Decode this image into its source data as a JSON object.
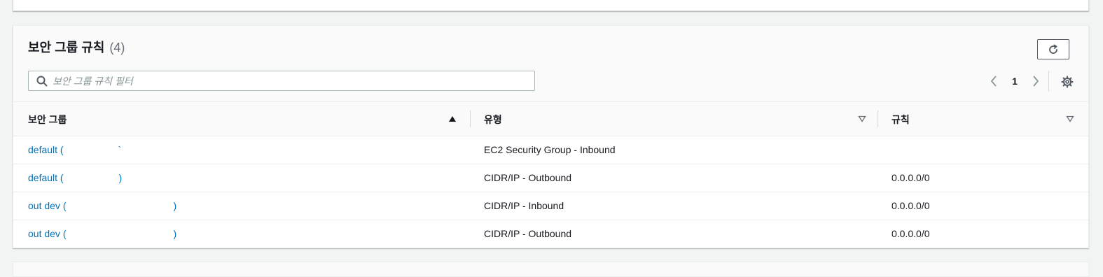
{
  "panel": {
    "title": "보안 그룹 규칙",
    "count": "(4)"
  },
  "search": {
    "placeholder": "보안 그룹 규칙 필터",
    "value": ""
  },
  "pagination": {
    "current_page": "1"
  },
  "icons": {
    "refresh": "refresh-icon",
    "search": "search-icon",
    "prev": "chevron-left-icon",
    "next": "chevron-right-icon",
    "settings": "gear-icon",
    "sort_asc": "sort-ascending-icon",
    "sort_none": "sort-descending-outline-icon"
  },
  "table": {
    "columns": [
      {
        "label": "보안 그룹",
        "sort": "ascending"
      },
      {
        "label": "유형",
        "sort": "none"
      },
      {
        "label": "규칙",
        "sort": "none"
      }
    ],
    "rows": [
      {
        "group": "default (",
        "group_tail": "`",
        "type": "EC2 Security Group - Inbound",
        "rule": ""
      },
      {
        "group": "default (",
        "group_tail": ")",
        "type": "CIDR/IP - Outbound",
        "rule": "0.0.0.0/0"
      },
      {
        "group": "out dev (",
        "group_tail": ")",
        "type": "CIDR/IP - Inbound",
        "rule": "0.0.0.0/0"
      },
      {
        "group": "out dev (",
        "group_tail": ")",
        "type": "CIDR/IP - Outbound",
        "rule": "0.0.0.0/0"
      }
    ]
  },
  "colors": {
    "link": "#0073bb",
    "header_bg": "#fafafa",
    "border": "#eaeded",
    "text": "#16191f"
  }
}
